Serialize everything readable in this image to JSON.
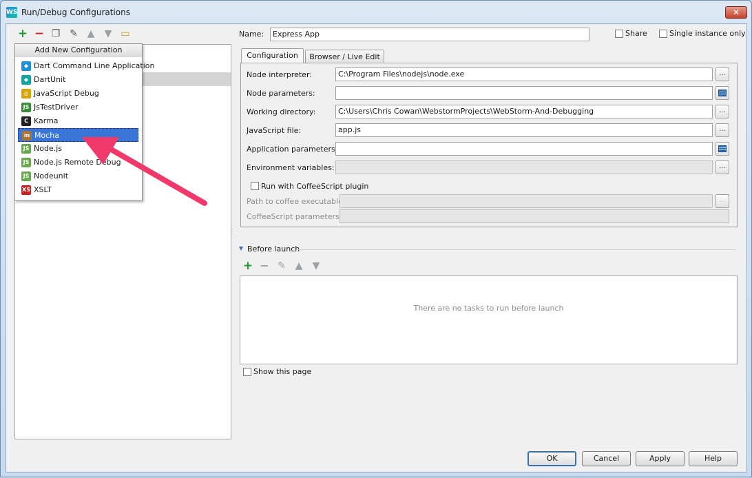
{
  "window": {
    "title": "Run/Debug Configurations",
    "app_icon_text": "WS",
    "close_glyph": "✕"
  },
  "toolbar": {
    "icons": [
      "plus-icon",
      "minus-icon",
      "copy-icon",
      "wrench-icon",
      "arrow-up-icon",
      "arrow-down-icon",
      "folder-icon"
    ]
  },
  "popup": {
    "header": "Add New Configuration",
    "items": [
      {
        "label": "Dart Command Line Application",
        "icon": "dart-icon",
        "badge": "◆",
        "color": "#1c8fd6"
      },
      {
        "label": "DartUnit",
        "icon": "dartunit-icon",
        "badge": "◆",
        "color": "#16a3a3"
      },
      {
        "label": "JavaScript Debug",
        "icon": "javascript-debug-icon",
        "badge": "◎",
        "color": "#d9a400"
      },
      {
        "label": "JsTestDriver",
        "icon": "jstestdriver-icon",
        "badge": "JS",
        "color": "#3a8a3a"
      },
      {
        "label": "Karma",
        "icon": "karma-icon",
        "badge": "C",
        "color": "#222222"
      },
      {
        "label": "Mocha",
        "icon": "mocha-icon",
        "badge": "m",
        "color": "#a8743a",
        "selected": true
      },
      {
        "label": "Node.js",
        "icon": "nodejs-icon",
        "badge": "JS",
        "color": "#6aa84f"
      },
      {
        "label": "Node.js Remote Debug",
        "icon": "nodejs-remote-debug-icon",
        "badge": "JS",
        "color": "#6aa84f"
      },
      {
        "label": "Nodeunit",
        "icon": "nodeunit-icon",
        "badge": "JS",
        "color": "#6aa84f"
      },
      {
        "label": "XSLT",
        "icon": "xslt-icon",
        "badge": "XS",
        "color": "#cc2222"
      }
    ]
  },
  "form": {
    "name_label": "Name:",
    "name_value": "Express App",
    "share_label": "Share",
    "single_instance_label": "Single instance only",
    "tabs": [
      {
        "label": "Configuration",
        "active": true
      },
      {
        "label": "Browser / Live Edit",
        "active": false
      }
    ],
    "node_interpreter_label": "Node interpreter:",
    "node_interpreter_value": "C:\\Program Files\\nodejs\\node.exe",
    "node_parameters_label": "Node parameters:",
    "node_parameters_value": "",
    "working_directory_label": "Working directory:",
    "working_directory_value": "C:\\Users\\Chris Cowan\\WebstormProjects\\WebStorm-And-Debugging",
    "javascript_file_label": "JavaScript file:",
    "javascript_file_value": "app.js",
    "application_parameters_label": "Application parameters:",
    "application_parameters_value": "",
    "environment_variables_label": "Environment variables:",
    "environment_variables_value": "",
    "coffeescript_plugin_label": "Run with CoffeeScript plugin",
    "coffee_path_label": "Path to coffee executable:",
    "coffee_params_label": "CoffeeScript parameters:",
    "browse_glyph": "..."
  },
  "before_launch": {
    "title": "Before launch",
    "empty_text": "There are no tasks to run before launch",
    "show_page_label": "Show this page"
  },
  "buttons": {
    "ok": "OK",
    "cancel": "Cancel",
    "apply": "Apply",
    "help": "Help"
  },
  "annotation": {
    "arrow_color": "#f0386b"
  }
}
